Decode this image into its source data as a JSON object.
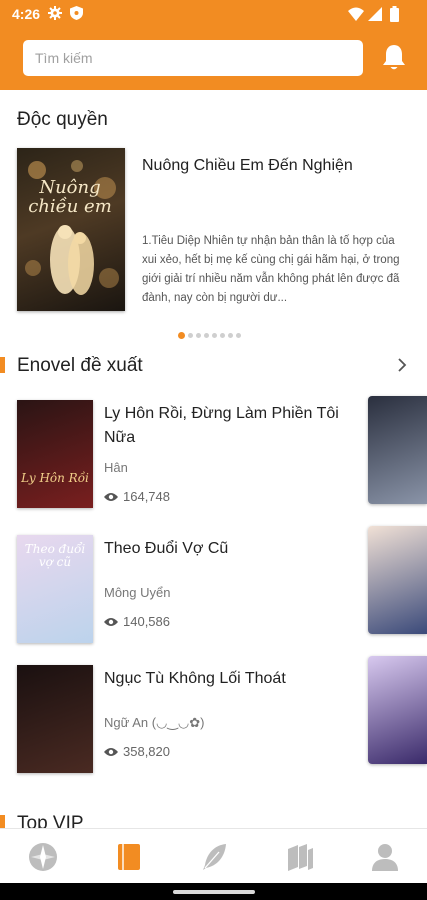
{
  "status": {
    "time": "4:26"
  },
  "search": {
    "placeholder": "Tìm kiếm"
  },
  "featured": {
    "section_title": "Độc quyền",
    "book": {
      "title": "Nuông Chiều Em Đến Nghiện",
      "cover_text": "Nuông chiều em",
      "description": "1.Tiêu Diệp Nhiên tự nhận bản thân là tố hợp của xui xẻo, hết bị mẹ kế cùng chị gái hãm hại, ở trong giới giải trí nhiều năm vẫn không phát lên được đã đành, nay còn bị người dư..."
    }
  },
  "carousel": {
    "count": 8,
    "active": 0
  },
  "recommend": {
    "section_title": "Enovel đề xuất",
    "books": [
      {
        "title": "Ly Hôn Rồi, Đừng Làm Phiền Tôi Nữa",
        "author": "Hân",
        "views": "164,748",
        "cover_text": "Ly Hôn Rồi",
        "cover_color_a": "#2a1414",
        "cover_color_b": "#7a1f1f",
        "cover_text_color": "#f2d08a"
      },
      {
        "title": "Theo Đuổi Vợ Cũ",
        "author": "Mông Uyển",
        "views": "140,586",
        "cover_text": "Theo đuổi vợ cũ",
        "cover_color_a": "#e8d8ee",
        "cover_color_b": "#bcd3ec",
        "cover_text_color": "#ffffff"
      },
      {
        "title": "Ngục Tù Không Lối Thoát",
        "author": "Ngữ An (◡‿◡✿)",
        "views": "358,820",
        "cover_text": "",
        "cover_color_a": "#1a1010",
        "cover_color_b": "#4a2a22",
        "cover_text_color": "#ffffff"
      }
    ],
    "side_covers": [
      {
        "cover_color_a": "#2a2f3e",
        "cover_color_b": "#8a94a8"
      },
      {
        "cover_color_a": "#f1e1d6",
        "cover_color_b": "#3b4a7a"
      },
      {
        "cover_color_a": "#d8c9ef",
        "cover_color_b": "#3a2a6a"
      }
    ]
  },
  "vip": {
    "section_title": "Top VIP"
  },
  "nav": {
    "active_index": 1,
    "items": [
      {
        "icon": "compass-icon"
      },
      {
        "icon": "book-icon"
      },
      {
        "icon": "feather-icon"
      },
      {
        "icon": "books-stack-icon"
      },
      {
        "icon": "person-icon"
      }
    ]
  },
  "colors": {
    "accent": "#f28c22",
    "nav_inactive": "#bdbdbd"
  }
}
